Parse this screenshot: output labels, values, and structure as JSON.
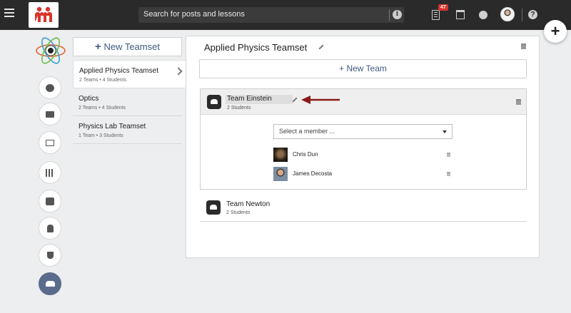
{
  "topbar": {
    "search_placeholder": "Search for posts and lessons",
    "notification_count": "47",
    "help_label": "?"
  },
  "fab_label": "+",
  "teamsets": {
    "new_label": "New Teamset",
    "items": [
      {
        "name": "Applied Physics Teamset",
        "meta": "2 Teams • 4 Students",
        "active": true
      },
      {
        "name": "Optics",
        "meta": "2 Teams • 4 Students",
        "active": false
      },
      {
        "name": "Physics Lab Teamset",
        "meta": "1 Team • 3 Students",
        "active": false
      }
    ]
  },
  "main": {
    "title": "Applied Physics Teamset",
    "new_team_label": "New Team",
    "teams": [
      {
        "name": "Team Einstein",
        "meta": "2 Students",
        "select_placeholder": "Select a member ...",
        "members": [
          "Chris Dun",
          "James Decosta"
        ]
      },
      {
        "name": "Team Newton",
        "meta": "2 Students"
      }
    ]
  },
  "colors": {
    "accent": "#3d5a80",
    "arrow": "#8b1a1a",
    "topbar": "#2a2a2a",
    "badge": "#d9342b"
  }
}
